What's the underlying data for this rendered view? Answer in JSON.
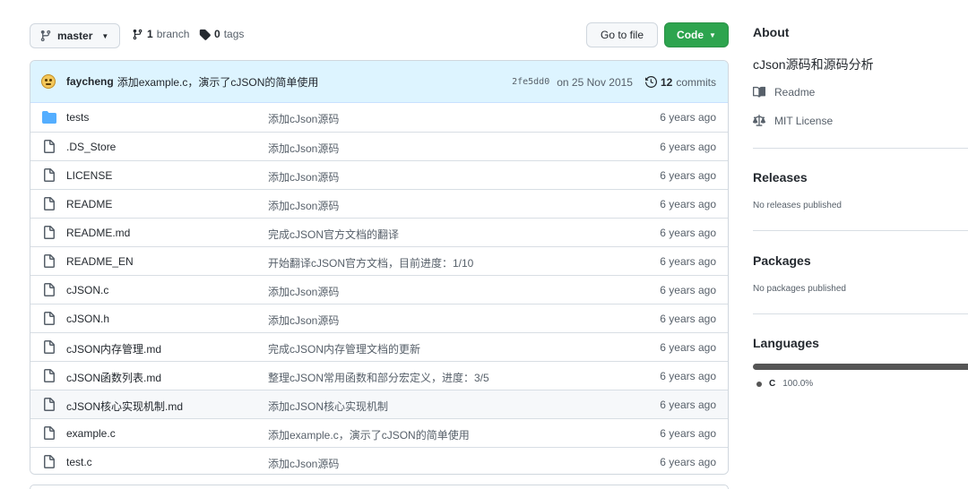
{
  "toolbar": {
    "branch_label": "master",
    "branch_count": "1",
    "branch_word": "branch",
    "tag_count": "0",
    "tag_word": "tags",
    "go_to_file": "Go to file",
    "code_label": "Code"
  },
  "commit": {
    "author": "faycheng",
    "message": "添加example.c，演示了cJSON的简单使用",
    "sha": "2fe5dd0",
    "date": "on 25 Nov 2015",
    "commit_count": "12",
    "commit_word": "commits"
  },
  "files": [
    {
      "name": "tests",
      "type": "folder",
      "message": "添加cJson源码",
      "age": "6 years ago"
    },
    {
      "name": ".DS_Store",
      "type": "file",
      "message": "添加cJson源码",
      "age": "6 years ago"
    },
    {
      "name": "LICENSE",
      "type": "file",
      "message": "添加cJson源码",
      "age": "6 years ago"
    },
    {
      "name": "README",
      "type": "file",
      "message": "添加cJson源码",
      "age": "6 years ago"
    },
    {
      "name": "README.md",
      "type": "file",
      "message": "完成cJSON官方文档的翻译",
      "age": "6 years ago"
    },
    {
      "name": "README_EN",
      "type": "file",
      "message": "开始翻译cJSON官方文档，目前进度：1/10",
      "age": "6 years ago"
    },
    {
      "name": "cJSON.c",
      "type": "file",
      "message": "添加cJson源码",
      "age": "6 years ago"
    },
    {
      "name": "cJSON.h",
      "type": "file",
      "message": "添加cJson源码",
      "age": "6 years ago"
    },
    {
      "name": "cJSON内存管理.md",
      "type": "file",
      "message": "完成cJSON内存管理文档的更新",
      "age": "6 years ago"
    },
    {
      "name": "cJSON函数列表.md",
      "type": "file",
      "message": "整理cJSON常用函数和部分宏定义，进度：3/5",
      "age": "6 years ago"
    },
    {
      "name": "cJSON核心实现机制.md",
      "type": "file",
      "message": "添加cJSON核心实现机制",
      "age": "6 years ago"
    },
    {
      "name": "example.c",
      "type": "file",
      "message": "添加example.c，演示了cJSON的简单使用",
      "age": "6 years ago"
    },
    {
      "name": "test.c",
      "type": "file",
      "message": "添加cJson源码",
      "age": "6 years ago"
    }
  ],
  "sidebar": {
    "about_heading": "About",
    "description": "cJson源码和源码分析",
    "readme_label": "Readme",
    "license_label": "MIT License",
    "releases_heading": "Releases",
    "releases_empty": "No releases published",
    "packages_heading": "Packages",
    "packages_empty": "No packages published",
    "languages_heading": "Languages",
    "language_name": "C",
    "language_percent": "100.0%"
  },
  "colors": {
    "code_button": "#2da44e",
    "commit_bar": "#ddf4ff",
    "folder_icon": "#54aeff",
    "language_c": "#555555"
  },
  "icons": {
    "branch": "git-branch-icon",
    "tag": "tag-icon",
    "history": "history-icon",
    "folder": "folder-icon",
    "file": "file-icon",
    "book": "book-icon",
    "law": "law-icon"
  }
}
